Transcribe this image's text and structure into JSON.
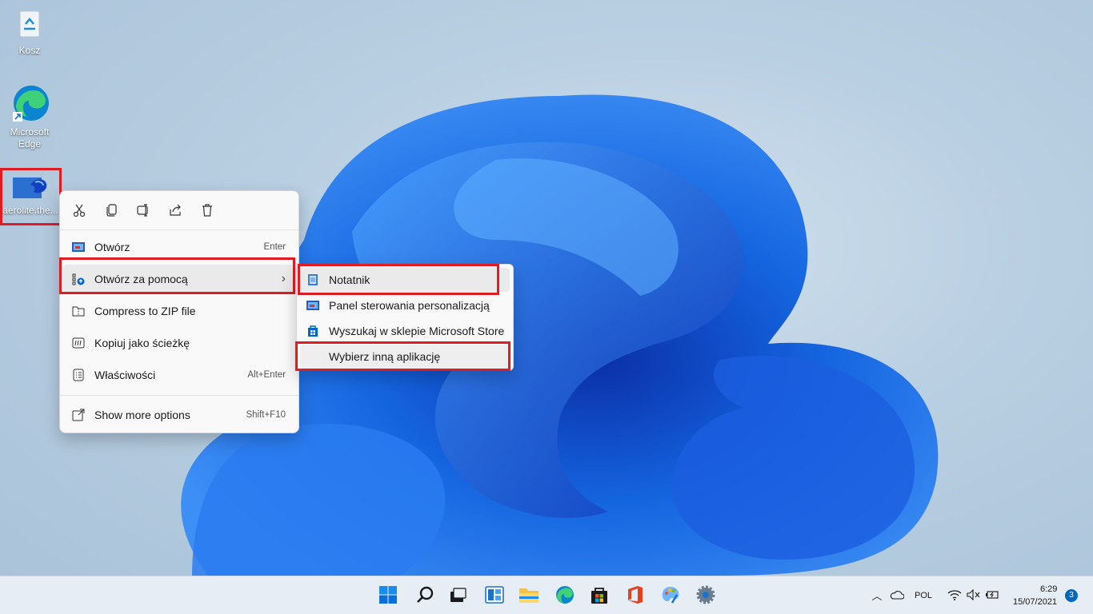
{
  "desktop": {
    "icons": [
      {
        "label": "Kosz"
      },
      {
        "label": "Microsoft Edge"
      },
      {
        "label": "aerolite.the..."
      }
    ]
  },
  "context_menu": {
    "toolbar": [
      "cut-icon",
      "copy-icon",
      "rename-icon",
      "share-icon",
      "delete-icon"
    ],
    "items": [
      {
        "label": "Otwórz",
        "shortcut": "Enter"
      },
      {
        "label": "Otwórz za pomocą",
        "shortcut": "›"
      },
      {
        "label": "Compress to ZIP file",
        "shortcut": ""
      },
      {
        "label": "Kopiuj jako ścieżkę",
        "shortcut": ""
      },
      {
        "label": "Właściwości",
        "shortcut": "Alt+Enter"
      },
      {
        "label": "Show more options",
        "shortcut": "Shift+F10"
      }
    ]
  },
  "submenu": {
    "items": [
      {
        "label": "Notatnik"
      },
      {
        "label": "Panel sterowania personalizacją"
      },
      {
        "label": "Wyszukaj w sklepie Microsoft Store"
      },
      {
        "label": "Wybierz inną aplikację"
      }
    ]
  },
  "taskbar": {
    "apps": [
      "start-icon",
      "search-icon",
      "task-view-icon",
      "widgets-icon",
      "file-explorer-icon",
      "edge-icon",
      "store-icon",
      "office-icon",
      "paint-icon",
      "settings-icon"
    ],
    "tray": {
      "language": "POL",
      "time": "6:29",
      "date": "15/07/2021",
      "notifications": "3"
    }
  },
  "colors": {
    "highlight": "#e11b22",
    "accent": "#0067c0"
  }
}
